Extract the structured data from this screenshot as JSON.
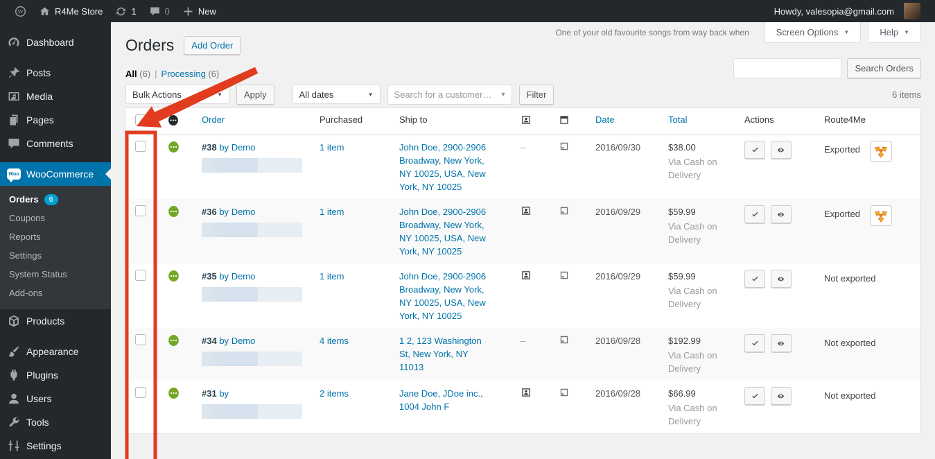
{
  "colors": {
    "accent_blue": "#0073aa",
    "annotation_red": "#e13b20",
    "status_green": "#73a724",
    "badge_cyan": "#00a0d2",
    "route4me_orange": "#f9b415"
  },
  "admin_bar": {
    "site_name": "R4Me Store",
    "update_count": "1",
    "comment_count": "0",
    "new_label": "New",
    "howdy": "Howdy, valesopia@gmail.com"
  },
  "sidebar": {
    "top_items": [
      {
        "label": "Dashboard",
        "icon": "dashboard-icon"
      },
      {
        "label": "Posts",
        "icon": "pushpin-icon",
        "gap": true
      },
      {
        "label": "Media",
        "icon": "media-icon"
      },
      {
        "label": "Pages",
        "icon": "pages-icon"
      },
      {
        "label": "Comments",
        "icon": "comments-icon"
      }
    ],
    "woocommerce_label": "WooCommerce",
    "woo_badge_text": "Woo",
    "submenu": [
      {
        "label": "Orders",
        "badge": "6",
        "current": true
      },
      {
        "label": "Coupons"
      },
      {
        "label": "Reports"
      },
      {
        "label": "Settings"
      },
      {
        "label": "System Status"
      },
      {
        "label": "Add-ons"
      }
    ],
    "bottom_items": [
      {
        "label": "Products",
        "icon": "products-icon"
      },
      {
        "label": "Appearance",
        "icon": "appearance-icon",
        "gap": true
      },
      {
        "label": "Plugins",
        "icon": "plugins-icon"
      },
      {
        "label": "Users",
        "icon": "users-icon"
      },
      {
        "label": "Tools",
        "icon": "tools-icon"
      },
      {
        "label": "Settings",
        "icon": "settings-icon"
      }
    ]
  },
  "header": {
    "page_title": "Orders",
    "add_order_label": "Add Order",
    "promo_text": "One of your old favourite songs from way back when",
    "screen_options_label": "Screen Options",
    "help_label": "Help",
    "search_button_label": "Search Orders",
    "search_value": ""
  },
  "views": {
    "all_label": "All",
    "all_count": "(6)",
    "separator": "|",
    "processing_label": "Processing",
    "processing_count": "(6)"
  },
  "toolbar": {
    "bulk_actions": "Bulk Actions",
    "apply_label": "Apply",
    "all_dates": "All dates",
    "customer_placeholder": "Search for a customer…",
    "filter_label": "Filter",
    "item_count": "6 items"
  },
  "table_headers": {
    "order": "Order",
    "purchased": "Purchased",
    "ship_to": "Ship to",
    "date": "Date",
    "total": "Total",
    "actions": "Actions",
    "route4me": "Route4Me"
  },
  "orders": [
    {
      "number": "#38",
      "by_label": "by",
      "customer": "Demo",
      "purchased": "1 item",
      "ship_to": "John Doe, 2900-2906 Broadway, New York, NY 10025, USA, New York, NY 10025",
      "has_person": false,
      "person_dash": "–",
      "date": "2016/09/30",
      "total": "$38.00",
      "via": "Via Cash on Delivery",
      "r4m_status": "Exported",
      "exported": true
    },
    {
      "number": "#36",
      "by_label": "by",
      "customer": "Demo",
      "purchased": "1 item",
      "ship_to": "John Doe, 2900-2906 Broadway, New York, NY 10025, USA, New York, NY 10025",
      "has_person": true,
      "date": "2016/09/29",
      "total": "$59.99",
      "via": "Via Cash on Delivery",
      "r4m_status": "Exported",
      "exported": true
    },
    {
      "number": "#35",
      "by_label": "by",
      "customer": "Demo",
      "purchased": "1 item",
      "ship_to": "John Doe, 2900-2906 Broadway, New York, NY 10025, USA, New York, NY 10025",
      "has_person": true,
      "date": "2016/09/29",
      "total": "$59.99",
      "via": "Via Cash on Delivery",
      "r4m_status": "Not exported",
      "exported": false
    },
    {
      "number": "#34",
      "by_label": "by",
      "customer": "Demo",
      "purchased": "4 items",
      "ship_to": "1 2, 123 Washington St, New York, NY 11013",
      "has_person": false,
      "person_dash": "–",
      "date": "2016/09/28",
      "total": "$192.99",
      "via": "Via Cash on Delivery",
      "r4m_status": "Not exported",
      "exported": false
    },
    {
      "number": "#31",
      "by_label": "by",
      "customer": "",
      "purchased": "2 items",
      "ship_to": "Jane Doe, JDoe inc., 1004 John F",
      "has_person": true,
      "date": "2016/09/28",
      "total": "$66.99",
      "via": "Via Cash on Delivery",
      "r4m_status": "Not exported",
      "exported": false
    }
  ]
}
